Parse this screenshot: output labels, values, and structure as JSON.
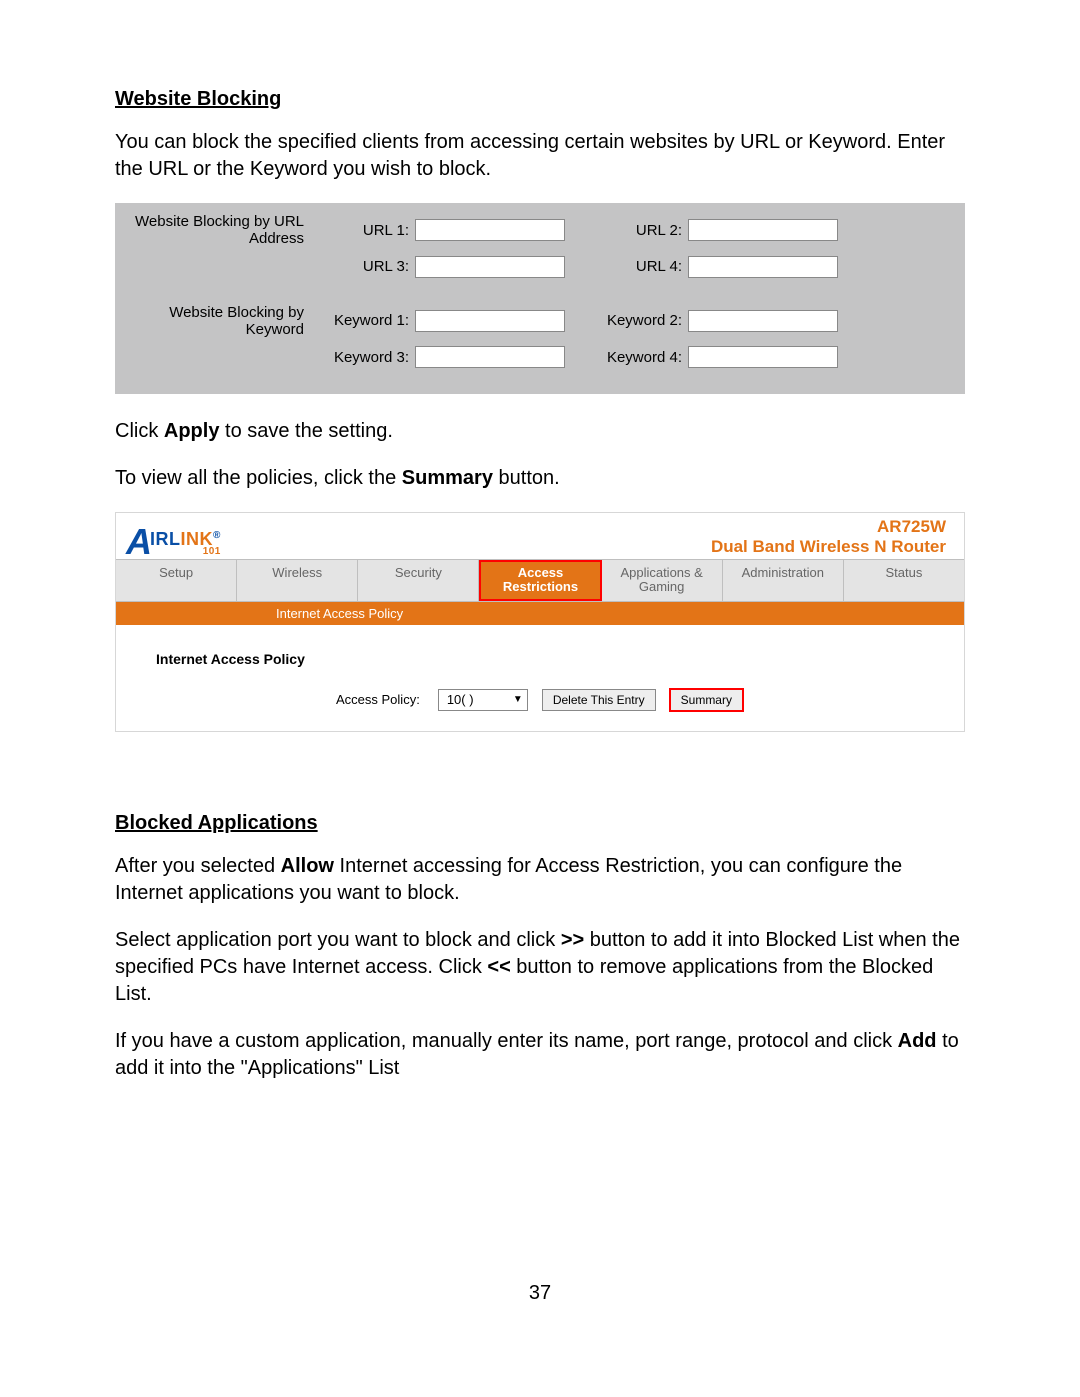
{
  "section1": {
    "heading": "Website Blocking",
    "intro": "You can block the specified clients from accessing certain websites by URL or Keyword. Enter the URL or the Keyword you wish to block."
  },
  "form_panel": {
    "url_group_label": "Website Blocking by URL Address",
    "url_labels": {
      "u1": "URL 1:",
      "u2": "URL 2:",
      "u3": "URL 3:",
      "u4": "URL 4:"
    },
    "kw_group_label": "Website Blocking by Keyword",
    "kw_labels": {
      "k1": "Keyword 1:",
      "k2": "Keyword 2:",
      "k3": "Keyword 3:",
      "k4": "Keyword 4:"
    }
  },
  "after_form": {
    "line1_a": "Click ",
    "line1_b": "Apply",
    "line1_c": " to save the setting.",
    "line2_a": "To view all the policies, click the ",
    "line2_b": "Summary",
    "line2_c": " button."
  },
  "router": {
    "logo_irl": "IRL",
    "logo_ink": "INK",
    "logo_reg": "®",
    "logo_101": "101",
    "model": "AR725W",
    "tagline": "Dual Band Wireless N Router",
    "tabs": {
      "setup": "Setup",
      "wireless": "Wireless",
      "security": "Security",
      "access": "Access Restrictions",
      "apps": "Applications & Gaming",
      "admin": "Administration",
      "status": "Status"
    },
    "subtab": "Internet Access Policy",
    "policy_title": "Internet Access Policy",
    "access_policy_label": "Access Policy:",
    "access_policy_value": "10( )",
    "delete_btn": "Delete This Entry",
    "summary_btn": "Summary"
  },
  "section2": {
    "heading": "Blocked Applications",
    "p1_a": "After you selected ",
    "p1_b": "Allow",
    "p1_c": " Internet accessing for Access Restriction, you can configure the Internet applications you want to block.",
    "p2_a": "Select application port you want to block and click ",
    "p2_b": ">>",
    "p2_c": " button to add it into Blocked List when the specified PCs have Internet access. Click ",
    "p2_d": "<<",
    "p2_e": " button to remove applications from the Blocked List.",
    "p3_a": "If you have a custom application, manually enter its name, port range, protocol and click ",
    "p3_b": "Add",
    "p3_c": " to add it into the \"Applications\" List"
  },
  "page_number": "37"
}
